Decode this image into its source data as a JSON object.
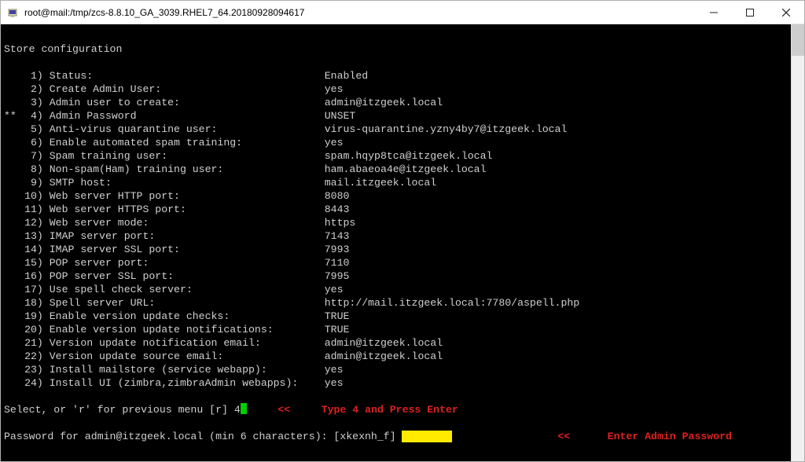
{
  "window": {
    "title": "root@mail:/tmp/zcs-8.8.10_GA_3039.RHEL7_64.20180928094617",
    "icon": "putty-icon"
  },
  "heading": "Store configuration",
  "menu_marker": "**",
  "items": [
    {
      "n": "1",
      "label": "Status:",
      "value": "Enabled",
      "marked": false
    },
    {
      "n": "2",
      "label": "Create Admin User:",
      "value": "yes",
      "marked": false
    },
    {
      "n": "3",
      "label": "Admin user to create:",
      "value": "admin@itzgeek.local",
      "marked": false
    },
    {
      "n": "4",
      "label": "Admin Password",
      "value": "UNSET",
      "marked": true
    },
    {
      "n": "5",
      "label": "Anti-virus quarantine user:",
      "value": "virus-quarantine.yzny4by7@itzgeek.local",
      "marked": false
    },
    {
      "n": "6",
      "label": "Enable automated spam training:",
      "value": "yes",
      "marked": false
    },
    {
      "n": "7",
      "label": "Spam training user:",
      "value": "spam.hqyp8tca@itzgeek.local",
      "marked": false
    },
    {
      "n": "8",
      "label": "Non-spam(Ham) training user:",
      "value": "ham.abaeoa4e@itzgeek.local",
      "marked": false
    },
    {
      "n": "9",
      "label": "SMTP host:",
      "value": "mail.itzgeek.local",
      "marked": false
    },
    {
      "n": "10",
      "label": "Web server HTTP port:",
      "value": "8080",
      "marked": false
    },
    {
      "n": "11",
      "label": "Web server HTTPS port:",
      "value": "8443",
      "marked": false
    },
    {
      "n": "12",
      "label": "Web server mode:",
      "value": "https",
      "marked": false
    },
    {
      "n": "13",
      "label": "IMAP server port:",
      "value": "7143",
      "marked": false
    },
    {
      "n": "14",
      "label": "IMAP server SSL port:",
      "value": "7993",
      "marked": false
    },
    {
      "n": "15",
      "label": "POP server port:",
      "value": "7110",
      "marked": false
    },
    {
      "n": "16",
      "label": "POP server SSL port:",
      "value": "7995",
      "marked": false
    },
    {
      "n": "17",
      "label": "Use spell check server:",
      "value": "yes",
      "marked": false
    },
    {
      "n": "18",
      "label": "Spell server URL:",
      "value": "http://mail.itzgeek.local:7780/aspell.php",
      "marked": false
    },
    {
      "n": "19",
      "label": "Enable version update checks:",
      "value": "TRUE",
      "marked": false
    },
    {
      "n": "20",
      "label": "Enable version update notifications:",
      "value": "TRUE",
      "marked": false
    },
    {
      "n": "21",
      "label": "Version update notification email:",
      "value": "admin@itzgeek.local",
      "marked": false
    },
    {
      "n": "22",
      "label": "Version update source email:",
      "value": "admin@itzgeek.local",
      "marked": false
    },
    {
      "n": "23",
      "label": "Install mailstore (service webapp):",
      "value": "yes",
      "marked": false
    },
    {
      "n": "24",
      "label": "Install UI (zimbra,zimbraAdmin webapps):",
      "value": "yes",
      "marked": false
    }
  ],
  "select_prompt": "Select, or 'r' for previous menu [r] ",
  "select_input": "4",
  "password_prompt": "Password for admin@itzgeek.local (min 6 characters): [xkexnh_f] ",
  "password_masked": "        ",
  "annotations": {
    "arrow": "<<",
    "type4": "Type 4 and Press Enter",
    "enterpw": "Enter Admin Password"
  }
}
